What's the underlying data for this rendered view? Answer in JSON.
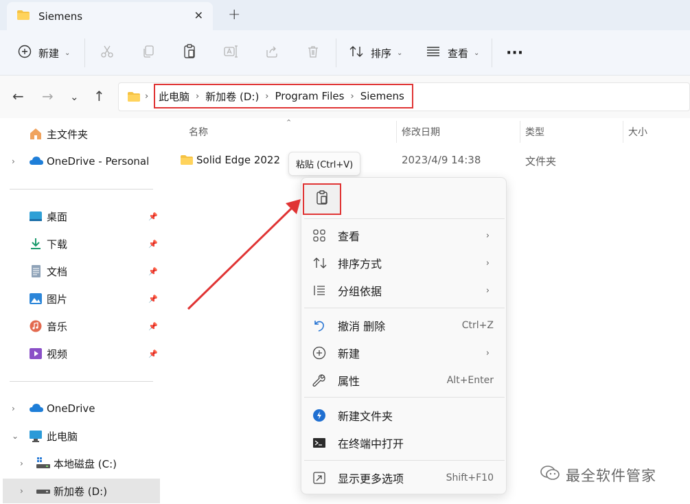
{
  "window": {
    "tab_title": "Siemens",
    "tab_close": "✕",
    "new_tab": "+"
  },
  "toolbar": {
    "new_label": "新建",
    "sort_label": "排序",
    "view_label": "查看",
    "more": "···"
  },
  "address": {
    "crumbs": [
      "此电脑",
      "新加卷 (D:)",
      "Program Files",
      "Siemens"
    ]
  },
  "sidebar": {
    "items": [
      {
        "label": "主文件夹"
      },
      {
        "label": "OneDrive - Personal"
      },
      {
        "label": "桌面"
      },
      {
        "label": "下载"
      },
      {
        "label": "文档"
      },
      {
        "label": "图片"
      },
      {
        "label": "音乐"
      },
      {
        "label": "视频"
      },
      {
        "label": "OneDrive"
      },
      {
        "label": "此电脑"
      },
      {
        "label": "本地磁盘 (C:)"
      },
      {
        "label": "新加卷 (D:)"
      }
    ]
  },
  "filelist": {
    "columns": [
      "名称",
      "修改日期",
      "类型",
      "大小"
    ],
    "rows": [
      {
        "name": "Solid Edge 2022",
        "date": "2023/4/9 14:38",
        "type": "文件夹"
      }
    ]
  },
  "tooltip": "粘贴 (Ctrl+V)",
  "context_menu": {
    "items": [
      {
        "label": "查看",
        "icon": "grid-view-icon"
      },
      {
        "label": "排序方式",
        "icon": "sort-icon"
      },
      {
        "label": "分组依据",
        "icon": "group-list-icon"
      },
      {
        "label": "撤消 删除",
        "shortcut": "Ctrl+Z",
        "icon": "undo-icon"
      },
      {
        "label": "新建",
        "icon": "plus-circle-icon"
      },
      {
        "label": "属性",
        "shortcut": "Alt+Enter",
        "icon": "wrench-icon"
      },
      {
        "label": "新建文件夹",
        "icon": "new-folder-icon"
      },
      {
        "label": "在终端中打开",
        "icon": "terminal-icon"
      },
      {
        "label": "显示更多选项",
        "shortcut": "Shift+F10",
        "icon": "more-options-icon"
      }
    ]
  },
  "watermark": "最全软件管家",
  "colors": {
    "highlight_red": "#e03434",
    "folder_yellow": "#f5c243",
    "accent_blue": "#0067c0"
  }
}
